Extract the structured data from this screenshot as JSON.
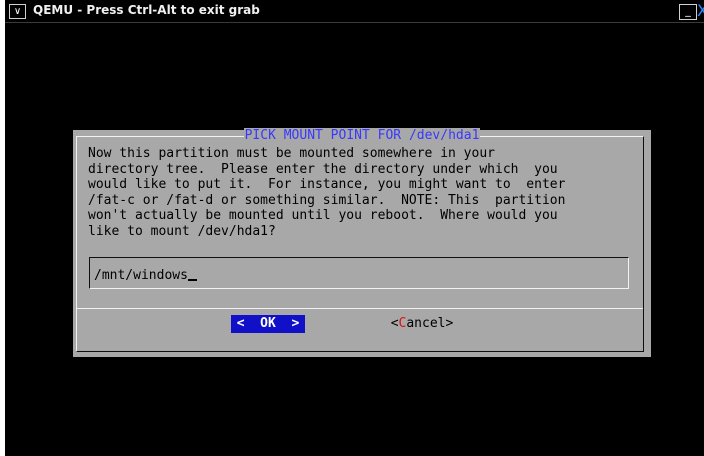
{
  "window": {
    "title": "QEMU - Press Ctrl-Alt to exit grab",
    "menu_glyph": "∨",
    "minimize_glyph": "_",
    "close_glyph": "X"
  },
  "dialog": {
    "title": "PICK MOUNT POINT FOR /dev/hda1",
    "body": "Now this partition must be mounted somewhere in your\ndirectory tree.  Please enter the directory under which  you\nwould like to put it.  For instance, you might want to  enter\n/fat-c or /fat-d or something similar.  NOTE: This  partition\nwon't actually be mounted until you reboot.  Where would you\nlike to mount /dev/hda1?",
    "input_value": "/mnt/windows",
    "ok_button": "<  OK  >",
    "cancel_button": {
      "prefix": "<",
      "hotkey": "C",
      "rest": "ancel>"
    }
  },
  "colors": {
    "dialog_bg": "#a8a8a8",
    "title_text": "#3838ff",
    "ok_bg": "#1010c8",
    "hotkey": "#e01010"
  }
}
